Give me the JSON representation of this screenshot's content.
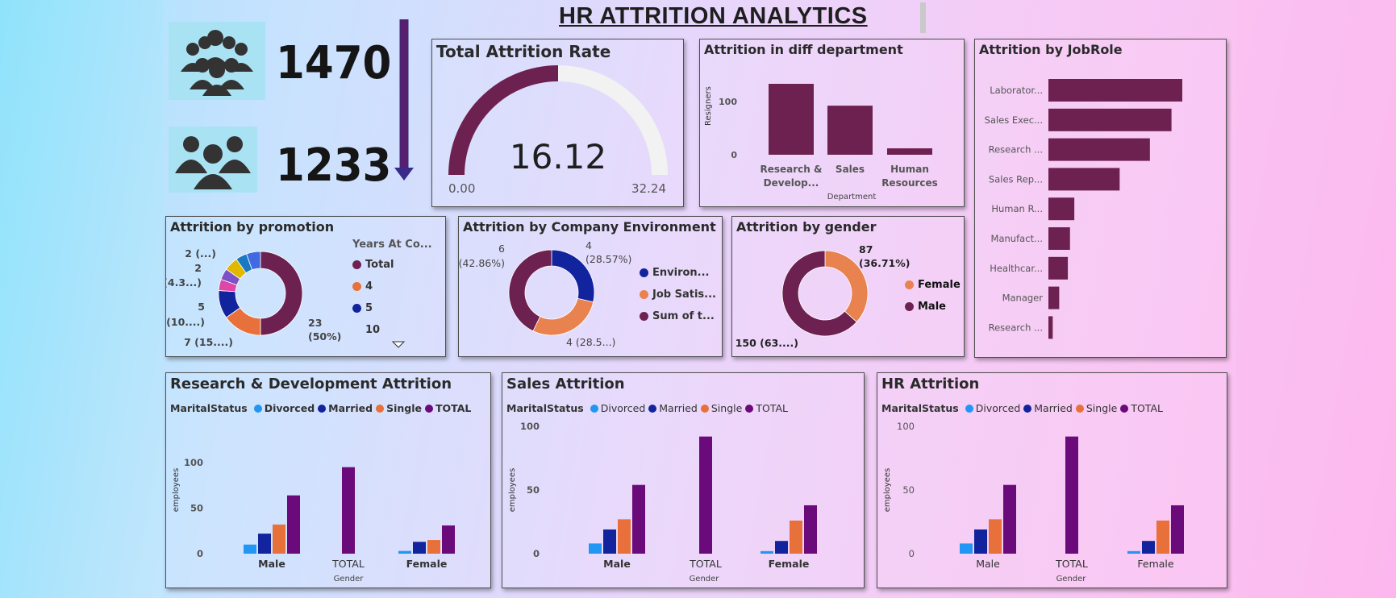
{
  "title": "HR ATTRITION ANALYTICS",
  "kpis": {
    "total_employees": "1470",
    "active_employees": "1233"
  },
  "colors": {
    "maroon": "#6d2150",
    "gauge_bg": "#f2f2f2",
    "divorced": "#2196f3",
    "married": "#12239e",
    "single": "#e8703a",
    "total": "#6b0a7a",
    "orange": "#e8824f",
    "navy": "#12239e"
  },
  "gauge": {
    "title": "Total Attrition Rate",
    "value": 16.12,
    "value_label": "16.12",
    "min_label": "0.00",
    "max_label": "32.24",
    "min": 0,
    "max": 32.24
  },
  "dept": {
    "title": "Attrition in diff department",
    "ylabel": "Resigners",
    "xlabel": "Department"
  },
  "jobrole": {
    "title": "Attrition by JobRole"
  },
  "promotion": {
    "title": "Attrition by promotion",
    "legend_title": "Years At Co...",
    "legend": [
      "Total",
      "4",
      "5",
      "10"
    ]
  },
  "environment": {
    "title": "Attrition by Company Environment",
    "legend": [
      "Environ...",
      "Job Satis...",
      "Sum of t..."
    ]
  },
  "gender": {
    "title": "Attrition by gender",
    "legend": [
      "Female",
      "Male"
    ]
  },
  "marital": {
    "rd_title": "Research & Development Attrition",
    "sales_title": "Sales Attrition",
    "hr_title": "HR Attrition",
    "legend_title": "MaritalStatus",
    "legend": [
      "Divorced",
      "Married",
      "Single",
      "TOTAL"
    ],
    "ylabel": "employees",
    "xlabel": "Gender"
  },
  "chart_data": [
    {
      "type": "gauge",
      "title": "Total Attrition Rate",
      "value": 16.12,
      "min": 0.0,
      "max": 32.24
    },
    {
      "type": "bar",
      "title": "Attrition in diff department",
      "categories": [
        "Research & Develop...",
        "Sales",
        "Human Resources"
      ],
      "values": [
        133,
        92,
        12
      ],
      "xlabel": "Department",
      "ylabel": "Resigners",
      "yticks": [
        0,
        100
      ]
    },
    {
      "type": "bar",
      "orientation": "horizontal",
      "title": "Attrition by JobRole",
      "categories": [
        "Laborator...",
        "Sales Exec...",
        "Research ...",
        "Sales Rep...",
        "Human R...",
        "Manufact...",
        "Healthcar...",
        "Manager",
        "Research ..."
      ],
      "values": [
        62,
        57,
        47,
        33,
        12,
        10,
        9,
        5,
        2
      ]
    },
    {
      "type": "pie",
      "donut": true,
      "title": "Attrition by promotion",
      "legend_title": "Years At Co...",
      "slices": [
        {
          "label": "Total",
          "value": 23,
          "display": "23 (50%)"
        },
        {
          "label": "4",
          "value": 7,
          "display": "7 (15....)"
        },
        {
          "label": "5",
          "value": 5,
          "display": "5 (10....)"
        },
        {
          "label": "10",
          "value": 2,
          "display": "2 (4.3...)"
        },
        {
          "label": "other",
          "value": 2,
          "display": "2 (...)"
        },
        {
          "label": "other",
          "value": 2.5
        },
        {
          "label": "other",
          "value": 2
        },
        {
          "label": "other",
          "value": 2.5
        }
      ]
    },
    {
      "type": "pie",
      "donut": true,
      "title": "Attrition by Company Environment",
      "slices": [
        {
          "label": "Environ...",
          "value": 4,
          "display": "4 (28.57%)"
        },
        {
          "label": "Job Satis...",
          "value": 4,
          "display": "4 (28.5...)"
        },
        {
          "label": "Sum of t...",
          "value": 6,
          "display": "6 (42.86%)"
        }
      ]
    },
    {
      "type": "pie",
      "donut": true,
      "title": "Attrition by gender",
      "slices": [
        {
          "label": "Female",
          "value": 87,
          "display": "87 (36.71%)"
        },
        {
          "label": "Male",
          "value": 150,
          "display": "150 (63....)"
        }
      ]
    },
    {
      "type": "bar",
      "title": "Research & Development Attrition",
      "categories": [
        "Male",
        "TOTAL",
        "Female"
      ],
      "xlabel": "Gender",
      "ylabel": "employees",
      "yticks": [
        0,
        50,
        100
      ],
      "ylim": [
        0,
        140
      ],
      "series": [
        {
          "name": "Divorced",
          "values": [
            10,
            null,
            3
          ]
        },
        {
          "name": "Married",
          "values": [
            22,
            null,
            13
          ]
        },
        {
          "name": "Single",
          "values": [
            32,
            null,
            15
          ]
        },
        {
          "name": "TOTAL",
          "values": [
            64,
            95,
            31
          ]
        }
      ]
    },
    {
      "type": "bar",
      "title": "Sales Attrition",
      "categories": [
        "Male",
        "TOTAL",
        "Female"
      ],
      "xlabel": "Gender",
      "ylabel": "employees",
      "yticks": [
        0,
        50,
        100
      ],
      "ylim": [
        0,
        100
      ],
      "series": [
        {
          "name": "Divorced",
          "values": [
            8,
            null,
            2
          ]
        },
        {
          "name": "Married",
          "values": [
            19,
            null,
            10
          ]
        },
        {
          "name": "Single",
          "values": [
            27,
            null,
            26
          ]
        },
        {
          "name": "TOTAL",
          "values": [
            54,
            92,
            38
          ]
        }
      ]
    },
    {
      "type": "bar",
      "title": "HR Attrition",
      "categories": [
        "Male",
        "TOTAL",
        "Female"
      ],
      "xlabel": "Gender",
      "ylabel": "employees",
      "yticks": [
        0,
        50,
        100
      ],
      "ylim": [
        0,
        100
      ],
      "series": [
        {
          "name": "Divorced",
          "values": [
            8,
            null,
            2
          ]
        },
        {
          "name": "Married",
          "values": [
            19,
            null,
            10
          ]
        },
        {
          "name": "Single",
          "values": [
            27,
            null,
            26
          ]
        },
        {
          "name": "TOTAL",
          "values": [
            54,
            92,
            38
          ]
        }
      ]
    }
  ]
}
